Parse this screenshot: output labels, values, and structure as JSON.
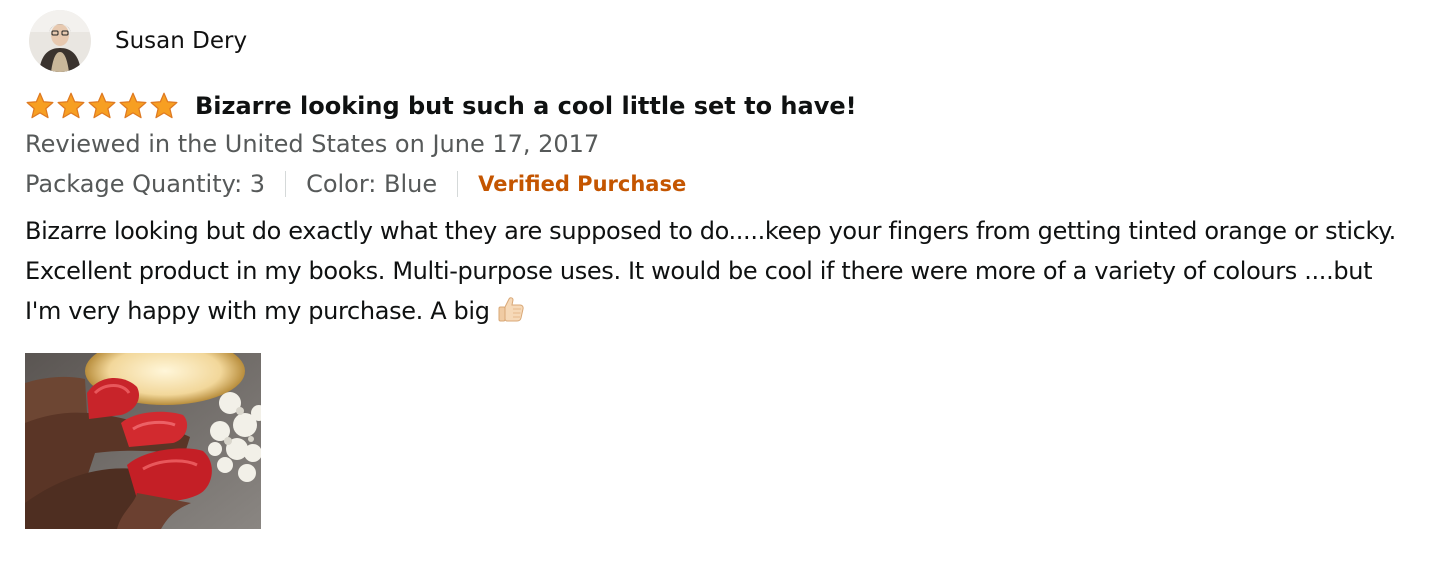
{
  "review": {
    "author_name": "Susan Dery",
    "rating": 5,
    "rating_max": 5,
    "title": "Bizarre looking but such a cool little set to have!",
    "date_line": "Reviewed in the United States on June 17, 2017",
    "package_quantity": "Package Quantity: 3",
    "color": "Color: Blue",
    "verified_label": "Verified Purchase",
    "body": "Bizarre looking but do exactly what they are supposed to do.....keep your fingers from getting tinted orange or sticky. Excellent product in my books. Multi-purpose uses. It would be cool if there were more of a variety of colours ....but I'm very happy with my purchase. A big",
    "body_emoji": "thumbs-up-icon",
    "star_color": "#f79f22",
    "verified_color": "#c45500"
  }
}
